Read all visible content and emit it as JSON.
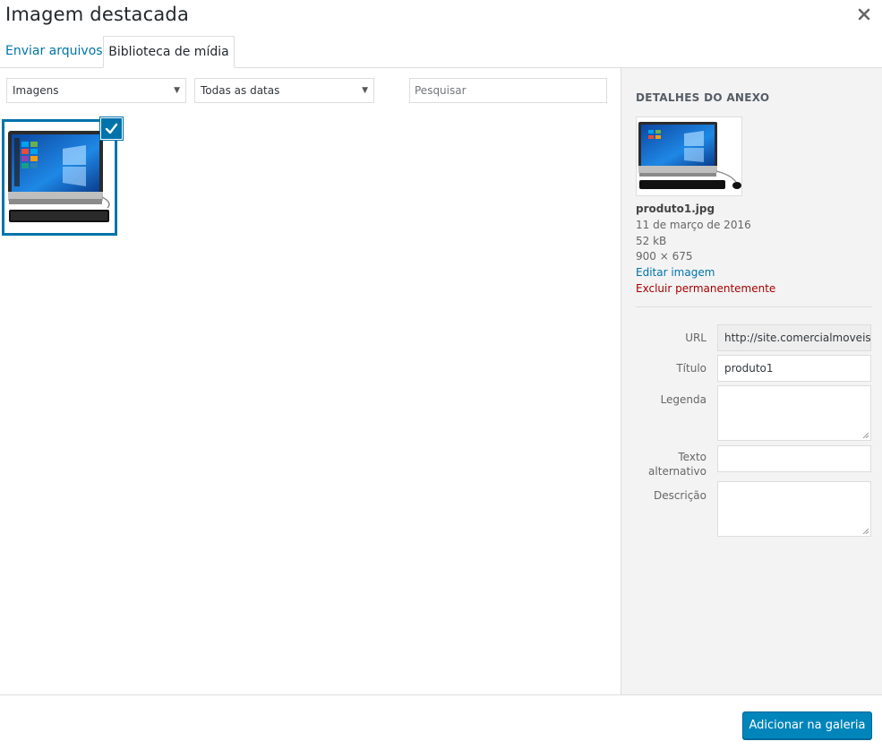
{
  "modal": {
    "title": "Imagem destacada",
    "close_icon": "close-icon"
  },
  "tabs": [
    {
      "label": "Enviar arquivos",
      "active": false
    },
    {
      "label": "Biblioteca de mídia",
      "active": true
    }
  ],
  "toolbar": {
    "type_filter": "Imagens",
    "date_filter": "Todas as datas",
    "search_placeholder": "Pesquisar"
  },
  "library": {
    "items": [
      {
        "thumbnail": "computer-thumbnail",
        "selected": true
      }
    ]
  },
  "sidebar": {
    "heading": "Detalhes do anexo",
    "filename": "produto1.jpg",
    "date": "11 de março de 2016",
    "size": "52 kB",
    "dimensions": "900 × 675",
    "edit_link": "Editar imagem",
    "delete_link": "Excluir permanentemente",
    "fields": {
      "url_label": "URL",
      "url_value": "http://site.comercialmoveis.",
      "title_label": "Título",
      "title_value": "produto1",
      "caption_label": "Legenda",
      "caption_value": "",
      "alt_label": "Texto alternativo",
      "alt_value": "",
      "description_label": "Descrição",
      "description_value": ""
    }
  },
  "footer": {
    "primary_button": "Adicionar na galeria"
  },
  "colors": {
    "accent": "#0073aa",
    "primary_button": "#0085ba",
    "danger": "#aa0000",
    "sidebar_bg": "#f3f3f3"
  }
}
